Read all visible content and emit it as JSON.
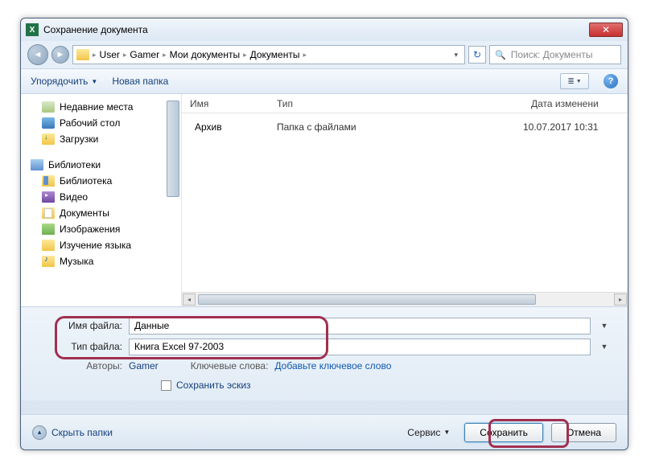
{
  "window": {
    "title": "Сохранение документа"
  },
  "nav": {
    "crumbs": [
      "User",
      "Gamer",
      "Мои документы",
      "Документы"
    ],
    "search_placeholder": "Поиск: Документы"
  },
  "toolbar": {
    "organize": "Упорядочить",
    "new_folder": "Новая папка"
  },
  "sidebar": {
    "items": [
      {
        "key": "recent",
        "label": "Недавние места",
        "icon": "ico-recent",
        "level": 1
      },
      {
        "key": "desktop",
        "label": "Рабочий стол",
        "icon": "ico-desktop",
        "level": 1
      },
      {
        "key": "downloads",
        "label": "Загрузки",
        "icon": "ico-downloads",
        "level": 1
      },
      {
        "key": "spacer",
        "label": "",
        "icon": "",
        "level": -1
      },
      {
        "key": "libraries",
        "label": "Библиотеки",
        "icon": "ico-lib-main",
        "level": 0
      },
      {
        "key": "library",
        "label": "Библиотека",
        "icon": "ico-lib",
        "level": 1
      },
      {
        "key": "video",
        "label": "Видео",
        "icon": "ico-video",
        "level": 1
      },
      {
        "key": "documents",
        "label": "Документы",
        "icon": "ico-docs",
        "level": 1
      },
      {
        "key": "pictures",
        "label": "Изображения",
        "icon": "ico-img",
        "level": 1
      },
      {
        "key": "lang",
        "label": "Изучение языка",
        "icon": "ico-folder",
        "level": 1
      },
      {
        "key": "music",
        "label": "Музыка",
        "icon": "ico-music",
        "level": 1
      }
    ]
  },
  "filelist": {
    "headers": {
      "name": "Имя",
      "type": "Тип",
      "date": "Дата изменени"
    },
    "rows": [
      {
        "name": "Архив",
        "type": "Папка с файлами",
        "date": "10.07.2017 10:31"
      }
    ]
  },
  "form": {
    "filename_label": "Имя файла:",
    "filename_value": "Данные",
    "filetype_label": "Тип файла:",
    "filetype_value": "Книга Excel 97-2003",
    "authors_label": "Авторы:",
    "authors_value": "Gamer",
    "keywords_label": "Ключевые слова:",
    "keywords_value": "Добавьте ключевое слово",
    "thumbnail_label": "Сохранить эскиз"
  },
  "footer": {
    "hide_folders": "Скрыть папки",
    "tools": "Сервис",
    "save": "Сохранить",
    "cancel": "Отмена"
  }
}
